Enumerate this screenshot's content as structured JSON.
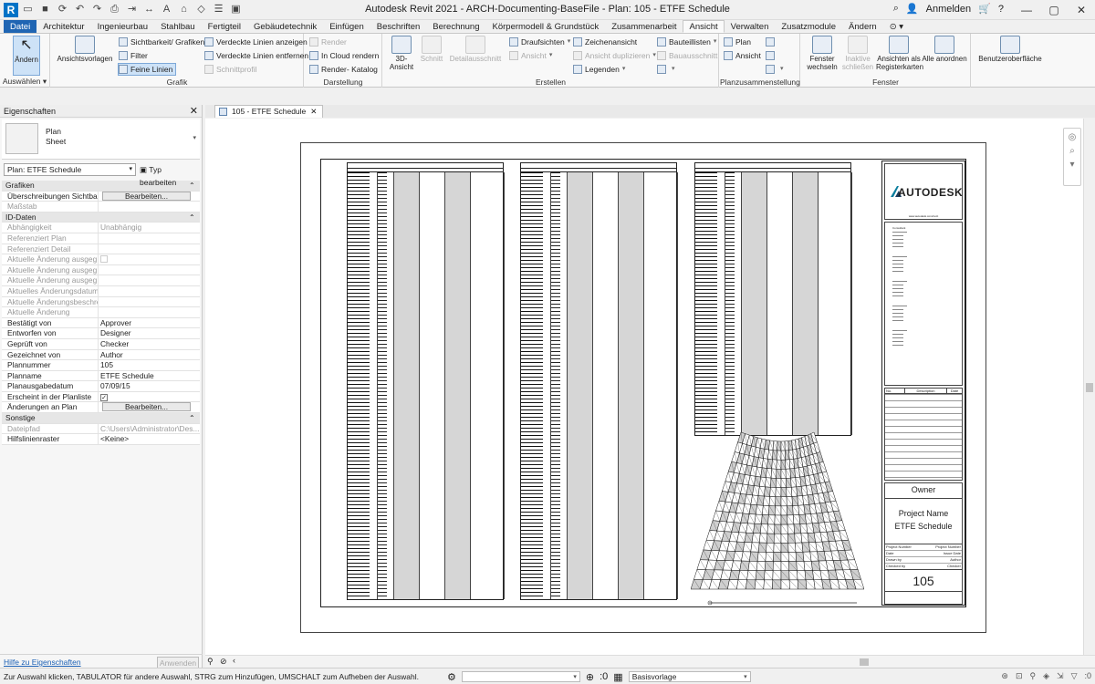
{
  "window": {
    "title": "Autodesk Revit 2021 - ARCH-Documenting-BaseFile - Plan: 105 - ETFE Schedule",
    "login": "Anmelden",
    "logo_letter": "R"
  },
  "tabs": [
    "Datei",
    "Architektur",
    "Ingenieurbau",
    "Stahlbau",
    "Fertigteil",
    "Gebäudetechnik",
    "Einfügen",
    "Beschriften",
    "Berechnung",
    "Körpermodell & Grundstück",
    "Zusammenarbeit",
    "Ansicht",
    "Verwalten",
    "Zusatzmodule",
    "Ändern",
    "⊙ ▾"
  ],
  "active_tab": "Ansicht",
  "ribbon": {
    "select": {
      "button": "Ändern",
      "panel": "Auswählen ▾"
    },
    "grafik": {
      "title": "Grafik",
      "ansichtsvorlagen": "Ansichtsvorlagen",
      "sichtbarkeit": "Sichtbarkeit/ Grafiken",
      "filter": "Filter",
      "feine_linien": "Feine Linien",
      "verdeckte_anzeigen": "Verdeckte Linien anzeigen",
      "verdeckte_entfernen": "Verdeckte Linien entfernen",
      "schnittprofil": "Schnittprofil"
    },
    "darstellung": {
      "title": "Darstellung",
      "render": "Render",
      "in_cloud": "In Cloud  rendern",
      "render_katalog": "Render- Katalog"
    },
    "erstellen": {
      "title": "Erstellen",
      "ansicht_3d": "3D- Ansicht",
      "schnitt": "Schnitt",
      "detailausschnitt": "Detailausschnitt",
      "draufsichten": "Draufsichten",
      "ansicht": "Ansicht",
      "zeichenansicht": "Zeichenansicht",
      "ansicht_duplizieren": "Ansicht duplizieren",
      "legenden": "Legenden",
      "bauteillisten": "Bauteillisten",
      "bauausschnitt": "Bauausschnitt"
    },
    "planzusammenstellung": {
      "title": "Planzusammenstellung",
      "plan": "Plan",
      "ansicht": "Ansicht"
    },
    "fenster": {
      "title": "Fenster",
      "wechseln": "Fenster wechseln",
      "inaktive": "Inaktive schließen",
      "register": "Ansichten als Registerkarten",
      "alle": "Alle anordnen"
    },
    "ui": "Benutzeroberfläche"
  },
  "properties": {
    "title": "Eigenschaften",
    "type_name": "Plan",
    "type_sub": "Sheet",
    "selector": "Plan: ETFE Schedule",
    "edit_type": "Typ bearbeiten",
    "rows": [
      {
        "kind": "section",
        "k": "Grafiken"
      },
      {
        "k": "Überschreibungen Sichtbar...",
        "v": "Bearbeiten...",
        "btn": true
      },
      {
        "k": "Maßstab",
        "v": "",
        "grey": true
      },
      {
        "kind": "section",
        "k": "ID-Daten"
      },
      {
        "k": "Abhängigkeit",
        "v": "Unabhängig",
        "grey": true
      },
      {
        "k": "Referenziert Plan",
        "v": "",
        "grey": true
      },
      {
        "k": "Referenziert Detail",
        "v": "",
        "grey": true
      },
      {
        "k": "Aktuelle Änderung ausgeg...",
        "v": "",
        "grey": true,
        "check": "off"
      },
      {
        "k": "Aktuelle Änderung ausgeg...",
        "v": "",
        "grey": true
      },
      {
        "k": "Aktuelle Änderung ausgeg...",
        "v": "",
        "grey": true
      },
      {
        "k": "Aktuelles Änderungsdatum",
        "v": "",
        "grey": true
      },
      {
        "k": "Aktuelle Änderungsbeschre...",
        "v": "",
        "grey": true
      },
      {
        "k": "Aktuelle Änderung",
        "v": "",
        "grey": true
      },
      {
        "k": "Bestätigt von",
        "v": "Approver"
      },
      {
        "k": "Entworfen von",
        "v": "Designer"
      },
      {
        "k": "Geprüft von",
        "v": "Checker"
      },
      {
        "k": "Gezeichnet von",
        "v": "Author"
      },
      {
        "k": "Plannummer",
        "v": "105"
      },
      {
        "k": "Planname",
        "v": "ETFE Schedule"
      },
      {
        "k": "Planausgabedatum",
        "v": "07/09/15"
      },
      {
        "k": "Erscheint in der Planliste",
        "v": "",
        "check": "on"
      },
      {
        "k": "Änderungen an Plan",
        "v": "Bearbeiten...",
        "btn": true
      },
      {
        "kind": "section",
        "k": "Sonstige"
      },
      {
        "k": "Dateipfad",
        "v": "C:\\Users\\Administrator\\Des...",
        "grey": true
      },
      {
        "k": "Hilfslinienraster",
        "v": "<Keine>"
      }
    ],
    "help": "Hilfe zu Eigenschaften",
    "apply": "Anwenden"
  },
  "document": {
    "tab": "105 - ETFE Schedule",
    "titleblock": {
      "brand": "AUTODESK",
      "website": "www.autodesk.com/revit",
      "consultant_label": "Consultant",
      "rev_headers": [
        "No.",
        "Description",
        "Date"
      ],
      "owner": "Owner",
      "project_name": "Project Name",
      "sheet_name": "ETFE Schedule",
      "fields": [
        {
          "k": "Project Number",
          "v": "Project Number"
        },
        {
          "k": "Date",
          "v": "Issue Date"
        },
        {
          "k": "Drawn by",
          "v": "Author"
        },
        {
          "k": "Checked by",
          "v": "Checker"
        }
      ],
      "sheet_number": "105"
    }
  },
  "status": {
    "text": "Zur Auswahl klicken, TABULATOR für andere Auswahl, STRG zum Hinzufügen, UMSCHALT zum Aufheben der Auswahl.",
    "counter": ":0",
    "template": "Basisvorlage",
    "counter2": ":0"
  },
  "colors": {
    "accent": "#1f65b3",
    "select_bg": "#cde2f7",
    "link": "#1a5fb4"
  }
}
